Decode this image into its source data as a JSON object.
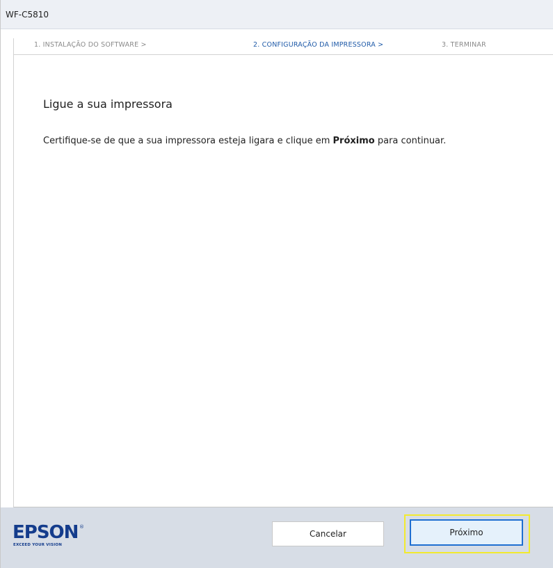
{
  "window": {
    "title": "WF-C5810"
  },
  "steps": [
    {
      "label": "1. INSTALAÇÃO DO SOFTWARE >",
      "state": "done"
    },
    {
      "label": "2. CONFIGURAÇÃO DA IMPRESSORA >",
      "state": "active"
    },
    {
      "label": "3. TERMINAR",
      "state": "pending"
    }
  ],
  "main": {
    "heading": "Ligue a sua impressora",
    "description_before": "Certifique-se de que a sua impressora esteja ligara e clique em ",
    "description_bold": "Próximo",
    "description_after": " para continuar."
  },
  "footer": {
    "logo_text": "EPSON",
    "logo_mark": "®",
    "logo_tagline": "EXCEED YOUR VISION",
    "cancel_label": "Cancelar",
    "next_label": "Próximo"
  },
  "colors": {
    "active_step": "#1f5aa8",
    "inactive_step": "#8a8a8a",
    "brand": "#143c8c",
    "footer_bg": "#d7dde6",
    "focus_border": "#1f6fd1",
    "highlight": "#f2ea2e"
  }
}
